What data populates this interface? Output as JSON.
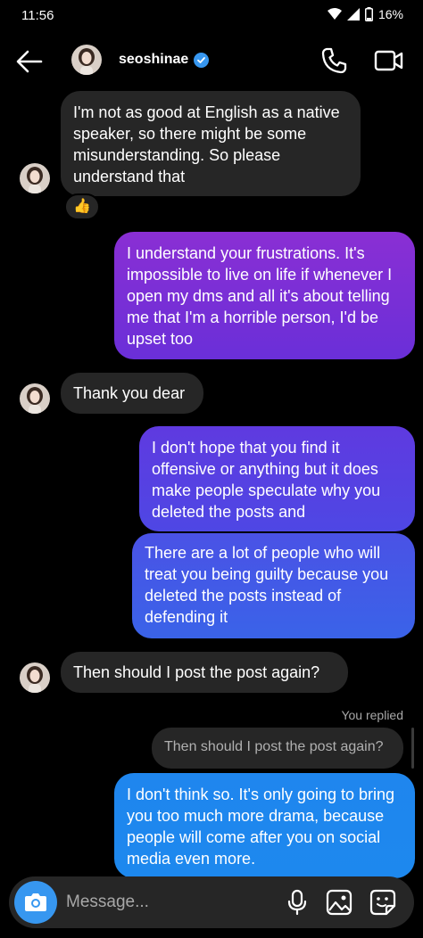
{
  "status_bar": {
    "time": "11:56",
    "battery": "16%"
  },
  "header": {
    "username": "seoshinae",
    "verified": true,
    "icons": [
      "back-arrow-icon",
      "phone-icon",
      "video-camera-icon"
    ]
  },
  "messages": [
    {
      "direction": "incoming",
      "text": "I'm not as good at English as a native speaker, so there might be some misunderstanding. So please understand that",
      "reaction": "👍"
    },
    {
      "direction": "outgoing",
      "text": "I understand your frustrations. It's impossible to live on life if whenever I open my dms and all it's about telling me that I'm a horrible person, I'd be upset too"
    },
    {
      "direction": "incoming",
      "text": "Thank you dear"
    },
    {
      "direction": "outgoing",
      "text": "I don't hope that you find it offensive or anything but it does make people speculate why you deleted the posts and"
    },
    {
      "direction": "outgoing",
      "text": "There are a lot of people who will treat you being guilty because you deleted the posts instead of defending it"
    },
    {
      "direction": "incoming",
      "text": "Then should I post the post again?"
    },
    {
      "direction": "outgoing",
      "reply_label": "You replied",
      "quoted_text": "Then should I post the post again?",
      "text": "I don't think so. It's only going to bring you too much more drama, because people will come after you on social media even more."
    }
  ],
  "composer": {
    "placeholder": "Message...",
    "value": "",
    "icons": [
      "camera-icon",
      "microphone-icon",
      "gallery-icon",
      "sticker-icon"
    ]
  },
  "colors": {
    "background": "#000000",
    "incoming_bubble": "#262626",
    "verified_badge": "#3797f0",
    "camera_button": "#3797f0"
  }
}
